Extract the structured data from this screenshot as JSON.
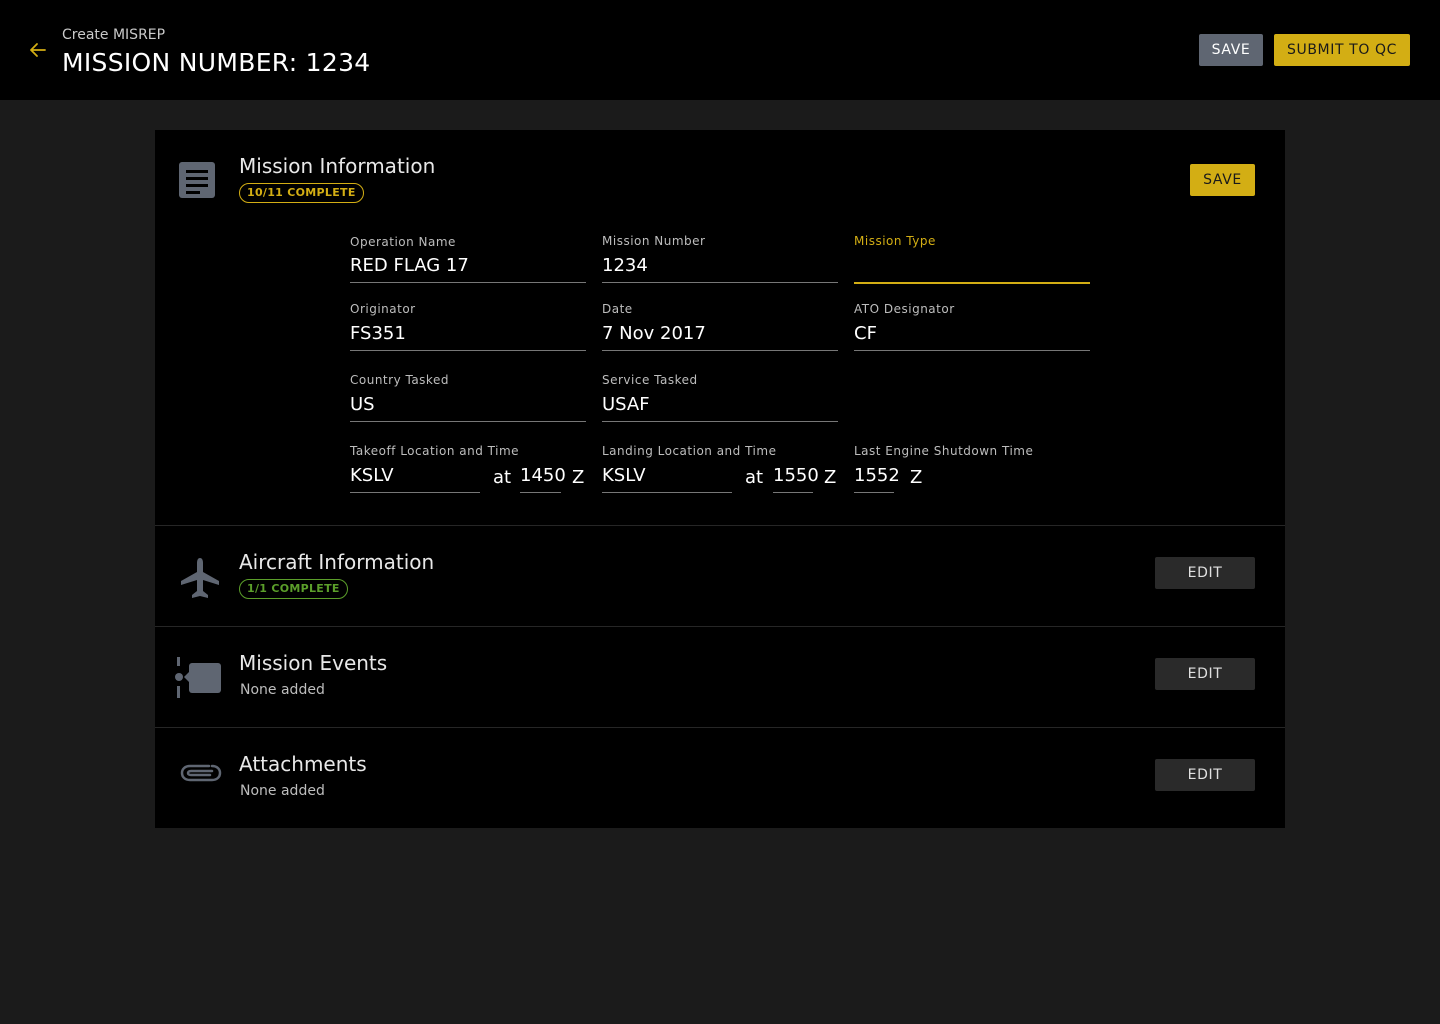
{
  "header": {
    "breadcrumb": "Create MISREP",
    "title": "MISSION NUMBER: 1234",
    "save_label": "SAVE",
    "submit_label": "SUBMIT TO QC"
  },
  "colors": {
    "accent": "#d3ae14",
    "complete_green": "#5b9e2a",
    "background": "#1b1b1b",
    "card": "#000000"
  },
  "mission_info": {
    "title": "Mission Information",
    "badge": "10/11 COMPLETE",
    "save_label": "SAVE",
    "icon": "document-icon",
    "fields": {
      "operation_name": {
        "label": "Operation Name",
        "value": "RED FLAG 17"
      },
      "mission_number": {
        "label": "Mission Number",
        "value": "1234"
      },
      "mission_type": {
        "label": "Mission Type",
        "value": ""
      },
      "originator": {
        "label": "Originator",
        "value": "FS351"
      },
      "date": {
        "label": "Date",
        "value": "7 Nov 2017"
      },
      "ato_designator": {
        "label": "ATO Designator",
        "value": "CF"
      },
      "country_tasked": {
        "label": "Country Tasked",
        "value": "US"
      },
      "service_tasked": {
        "label": "Service Tasked",
        "value": "USAF"
      },
      "takeoff": {
        "label": "Takeoff Location and Time",
        "location": "KSLV",
        "at": "at",
        "time": "1450",
        "zone": "Z"
      },
      "landing": {
        "label": "Landing Location and Time",
        "location": "KSLV",
        "at": "at",
        "time": "1550",
        "zone": "Z"
      },
      "shutdown": {
        "label": "Last Engine Shutdown Time",
        "time": "1552",
        "zone": "Z"
      }
    }
  },
  "aircraft_info": {
    "title": "Aircraft Information",
    "badge": "1/1 COMPLETE",
    "edit_label": "EDIT",
    "icon": "airplane-icon"
  },
  "mission_events": {
    "title": "Mission Events",
    "subtitle": "None added",
    "edit_label": "EDIT",
    "icon": "timeline-icon"
  },
  "attachments": {
    "title": "Attachments",
    "subtitle": "None added",
    "edit_label": "EDIT",
    "icon": "paperclip-icon"
  }
}
